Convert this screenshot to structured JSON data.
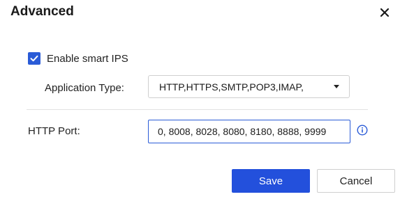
{
  "dialog": {
    "title": "Advanced",
    "close_icon": "close-icon"
  },
  "smart_ips": {
    "label": "Enable smart IPS",
    "checked": true,
    "accent_color": "#2a5bd7"
  },
  "application_type": {
    "label": "Application Type:",
    "selected": "HTTP,HTTPS,SMTP,POP3,IMAP,"
  },
  "http_port": {
    "label": "HTTP Port:",
    "value": "0, 8008, 8028, 8080, 8180, 8888, 9999",
    "info_icon": "info-icon"
  },
  "buttons": {
    "save_label": "Save",
    "cancel_label": "Cancel",
    "save_color": "#2350dc"
  }
}
